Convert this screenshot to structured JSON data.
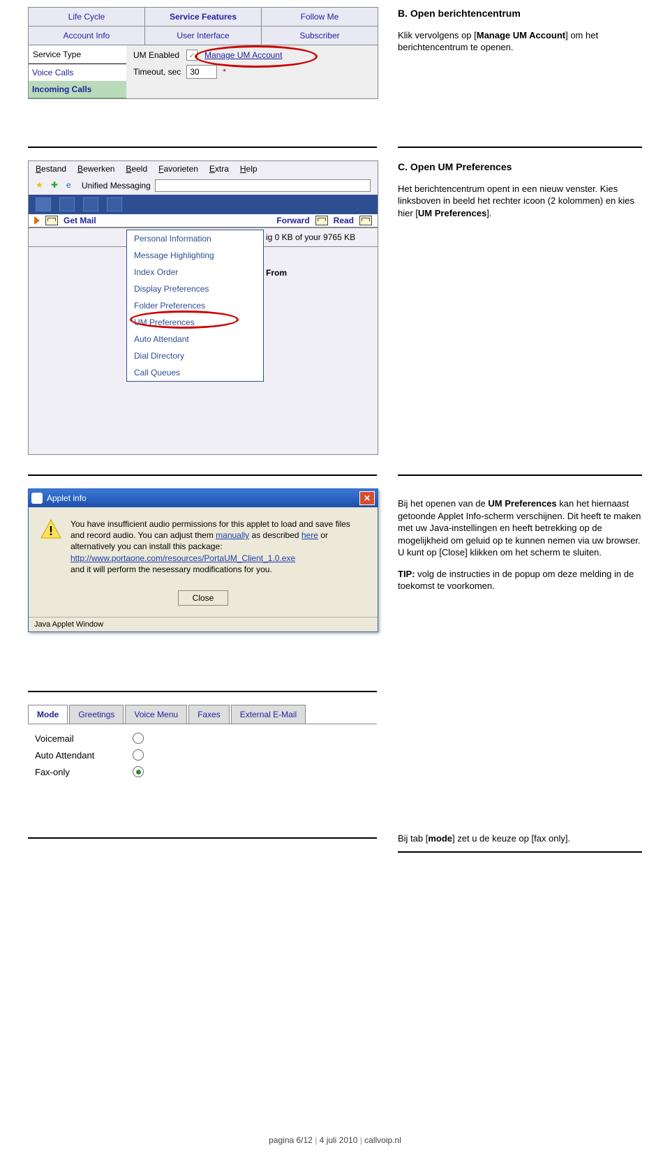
{
  "titleB": "B. Open berichtencentrum",
  "textB_part1": "Klik vervolgens op [",
  "textB_bold": "Manage UM Account",
  "textB_part2": "] om het berichtencentrum te openen.",
  "shot1": {
    "tabs_row1": [
      "Life Cycle",
      "Service Features",
      "Follow Me"
    ],
    "tabs_row2": [
      "Account Info",
      "User Interface",
      "Subscriber"
    ],
    "service_type_label": "Service Type",
    "voice_calls": "Voice Calls",
    "incoming_calls": "Incoming Calls",
    "um_enabled": "UM Enabled",
    "manage_um": "Manage UM Account",
    "timeout": "Timeout, sec",
    "timeout_val": "30"
  },
  "titleC": "C. Open UM Preferences",
  "textC_1": "Het berichtencentrum opent in een nieuw venster. Kies linksboven in beeld het rechter icoon (2 kolommen) en kies hier [",
  "textC_bold": "UM Preferences",
  "textC_2": "].",
  "browser": {
    "menu": [
      "Bestand",
      "Bewerken",
      "Beeld",
      "Favorieten",
      "Extra",
      "Help"
    ],
    "pagetitle": "Unified Messaging",
    "getmail": "Get Mail",
    "forward": "Forward",
    "read": "Read",
    "usage": "ig 0 KB of your 9765 KB",
    "from": "From",
    "menuitems": [
      "Personal Information",
      "Message Highlighting",
      "Index Order",
      "Display Preferences",
      "Folder Preferences",
      "UM Preferences",
      "Auto Attendant",
      "Dial Directory",
      "Call Queues"
    ]
  },
  "applet": {
    "title": "Applet info",
    "msg1": "You have insufficient audio permissions for this applet to load and save files and record audio. You can adjust them ",
    "manually": "manually",
    "msg2": " as described ",
    "here": "here",
    "msg3": " or alternatively you can install this package:",
    "url": "http://www.portaone.com/resources/PortaUM_Client_1.0.exe",
    "msg4": "and it will perform the nesessary modifications for you.",
    "close": "Close",
    "status": "Java Applet Window"
  },
  "explApplet_1a": "Bij het openen van de ",
  "explApplet_1b": "UM Preferences",
  "explApplet_1c": " kan het hiernaast getoonde Applet Info-scherm verschijnen. Dit heeft te maken met uw Java-instellingen en heeft betrekking op de mogelijkheid om geluid op te kunnen nemen via uw browser. U kunt op [Close] klikken om het scherm te sluiten.",
  "explApplet_tip_label": "TIP:",
  "explApplet_tip": " volg de instructies in de popup om deze melding in de toekomst te voorkomen.",
  "explMode_1": "Bij tab [",
  "explMode_bold": "mode",
  "explMode_2": "] zet u de keuze op [fax only].",
  "mode": {
    "tabs": [
      "Mode",
      "Greetings",
      "Voice Menu",
      "Faxes",
      "External E-Mail"
    ],
    "options": [
      "Voicemail",
      "Auto Attendant",
      "Fax-only"
    ]
  },
  "footer": {
    "page": "pagina 6/12",
    "date": "4 juli 2010",
    "site": "callvoip.nl"
  }
}
